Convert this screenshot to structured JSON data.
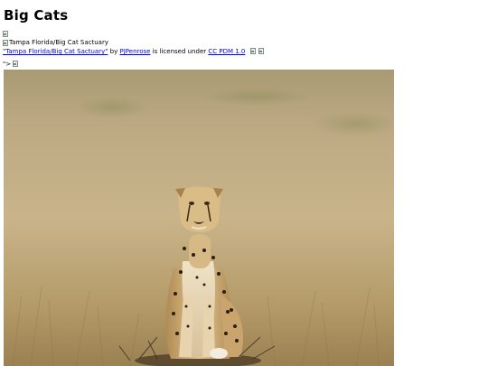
{
  "page": {
    "title": "Big Cats"
  },
  "first_image": {
    "alt": "Tampa Florida/Big Cat Sactuary"
  },
  "attribution": {
    "work_link": "\"Tampa Florida/Big Cat Sactuary\"",
    "by_text": "by",
    "author_link": "PJPenrose",
    "license_text": "is licensed under",
    "license_link": "CC PDM 1.0"
  },
  "stray_markup": {
    "text": "\">"
  },
  "colors": {
    "link": "#0000ee",
    "grass_light": "#c9b48a",
    "grass_dark": "#8f7a4e"
  },
  "icons": [
    "broken-image-icon",
    "license-icon"
  ]
}
